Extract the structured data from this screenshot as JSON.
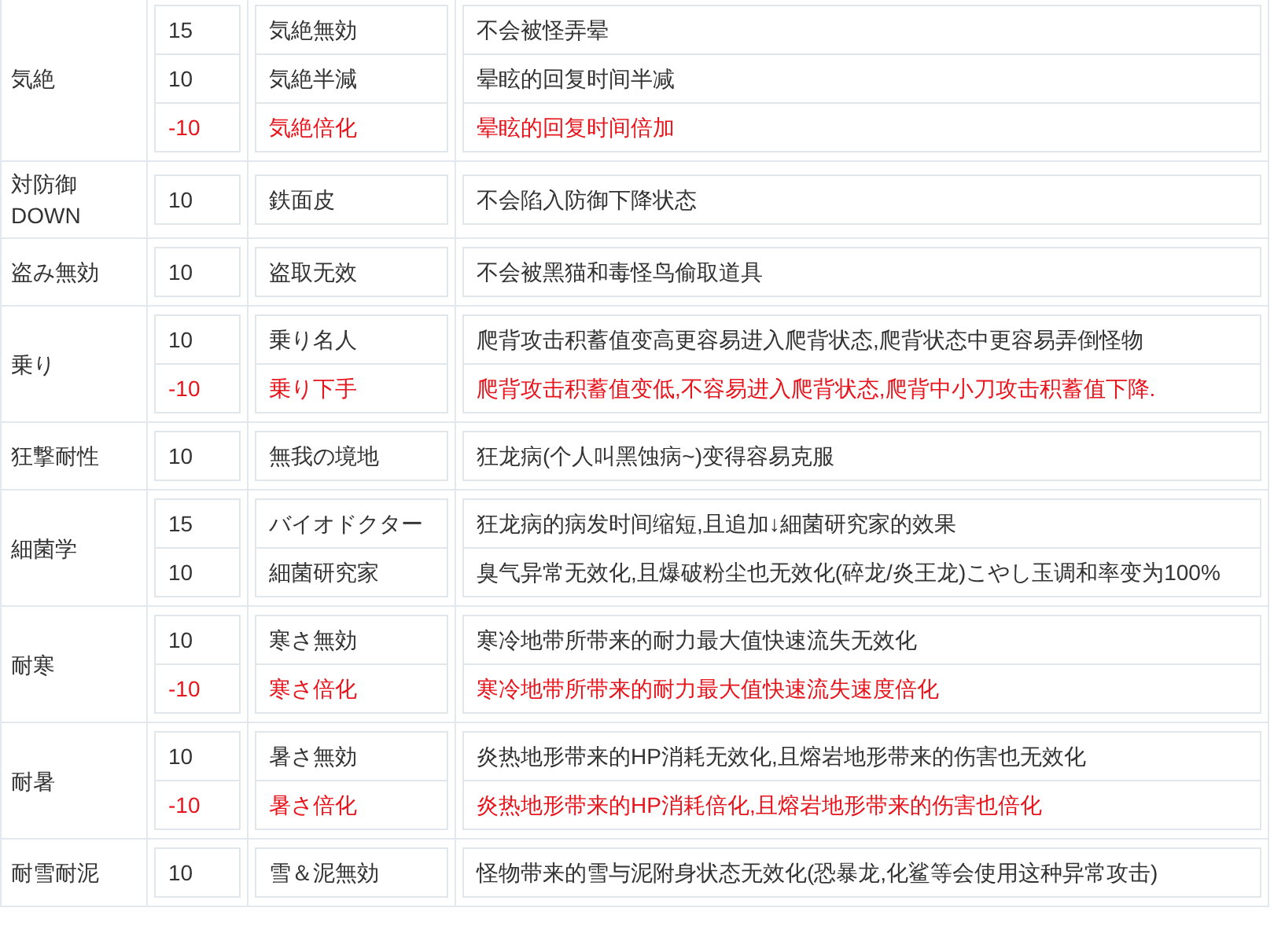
{
  "groups": [
    {
      "skill": "気絶",
      "entries": [
        {
          "points": "15",
          "name": "気絶無効",
          "effect": "不会被怪弄晕",
          "negative": false
        },
        {
          "points": "10",
          "name": "気絶半減",
          "effect": "晕眩的回复时间半减",
          "negative": false
        },
        {
          "points": "-10",
          "name": "気絶倍化",
          "effect": "晕眩的回复时间倍加",
          "negative": true
        }
      ]
    },
    {
      "skill": "対防御 DOWN",
      "entries": [
        {
          "points": "10",
          "name": "鉄面皮",
          "effect": "不会陷入防御下降状态",
          "negative": false
        }
      ]
    },
    {
      "skill": "盗み無効",
      "entries": [
        {
          "points": "10",
          "name": "盗取无效",
          "effect": "不会被黑猫和毒怪鸟偷取道具",
          "negative": false
        }
      ]
    },
    {
      "skill": "乗り",
      "entries": [
        {
          "points": "10",
          "name": "乗り名人",
          "effect": "爬背攻击积蓄值变高更容易进入爬背状态,爬背状态中更容易弄倒怪物",
          "negative": false
        },
        {
          "points": "-10",
          "name": "乗り下手",
          "effect": "爬背攻击积蓄值变低,不容易进入爬背状态,爬背中小刀攻击积蓄值下降.",
          "negative": true
        }
      ]
    },
    {
      "skill": "狂撃耐性",
      "entries": [
        {
          "points": "10",
          "name": "無我の境地",
          "effect": "狂龙病(个人叫黑蚀病~)变得容易克服",
          "negative": false
        }
      ]
    },
    {
      "skill": "細菌学",
      "entries": [
        {
          "points": "15",
          "name": "バイオドクター",
          "effect": "狂龙病的病发时间缩短,且追加↓細菌研究家的效果",
          "negative": false
        },
        {
          "points": "10",
          "name": "細菌研究家",
          "effect": "臭气异常无效化,且爆破粉尘也无效化(碎龙/炎王龙)こやし玉调和率变为100%",
          "negative": false
        }
      ]
    },
    {
      "skill": "耐寒",
      "entries": [
        {
          "points": "10",
          "name": "寒さ無効",
          "effect": "寒冷地带所带来的耐力最大值快速流失无效化",
          "negative": false
        },
        {
          "points": "-10",
          "name": "寒さ倍化",
          "effect": "寒冷地带所带来的耐力最大值快速流失速度倍化",
          "negative": true
        }
      ]
    },
    {
      "skill": "耐暑",
      "entries": [
        {
          "points": "10",
          "name": "暑さ無効",
          "effect": "炎热地形带来的HP消耗无效化,且熔岩地形带来的伤害也无效化",
          "negative": false
        },
        {
          "points": "-10",
          "name": "暑さ倍化",
          "effect": "炎热地形带来的HP消耗倍化,且熔岩地形带来的伤害也倍化",
          "negative": true
        }
      ]
    },
    {
      "skill": "耐雪耐泥",
      "entries": [
        {
          "points": "10",
          "name": "雪＆泥無効",
          "effect": "怪物带来的雪与泥附身状态无效化(恐暴龙,化鲨等会使用这种异常攻击)",
          "negative": false
        }
      ]
    }
  ]
}
